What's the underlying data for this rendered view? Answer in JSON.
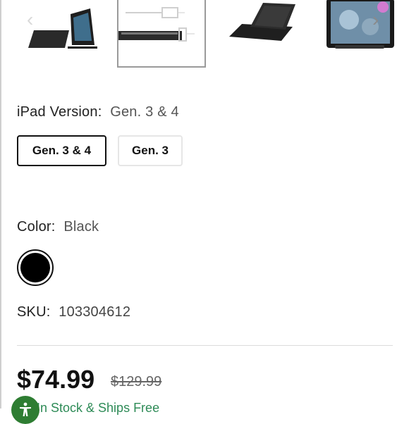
{
  "gallery": {
    "thumbnails": [
      {
        "alt": "keyboard-case-open-icon"
      },
      {
        "alt": "keyboard-case-side-diagram-icon"
      },
      {
        "alt": "keyboard-case-closed-icon"
      },
      {
        "alt": "ipad-with-pencil-icon"
      }
    ],
    "prev_icon": "chevron-left-icon",
    "next_icon": "chevron-right-icon"
  },
  "ipad_version": {
    "label": "iPad Version:",
    "selected_value": "Gen. 3 & 4",
    "options": [
      "Gen. 3 & 4",
      "Gen. 3"
    ]
  },
  "color": {
    "label": "Color:",
    "selected_value": "Black",
    "swatch_color": "#000000"
  },
  "sku": {
    "label": "SKU:",
    "value": "103304612"
  },
  "pricing": {
    "price": "$74.99",
    "original_price": "$129.99"
  },
  "stock": {
    "text": "In Stock & Ships Free"
  },
  "colors": {
    "stock_green": "#2e8b57",
    "accessibility_button": "#2e7d32"
  }
}
